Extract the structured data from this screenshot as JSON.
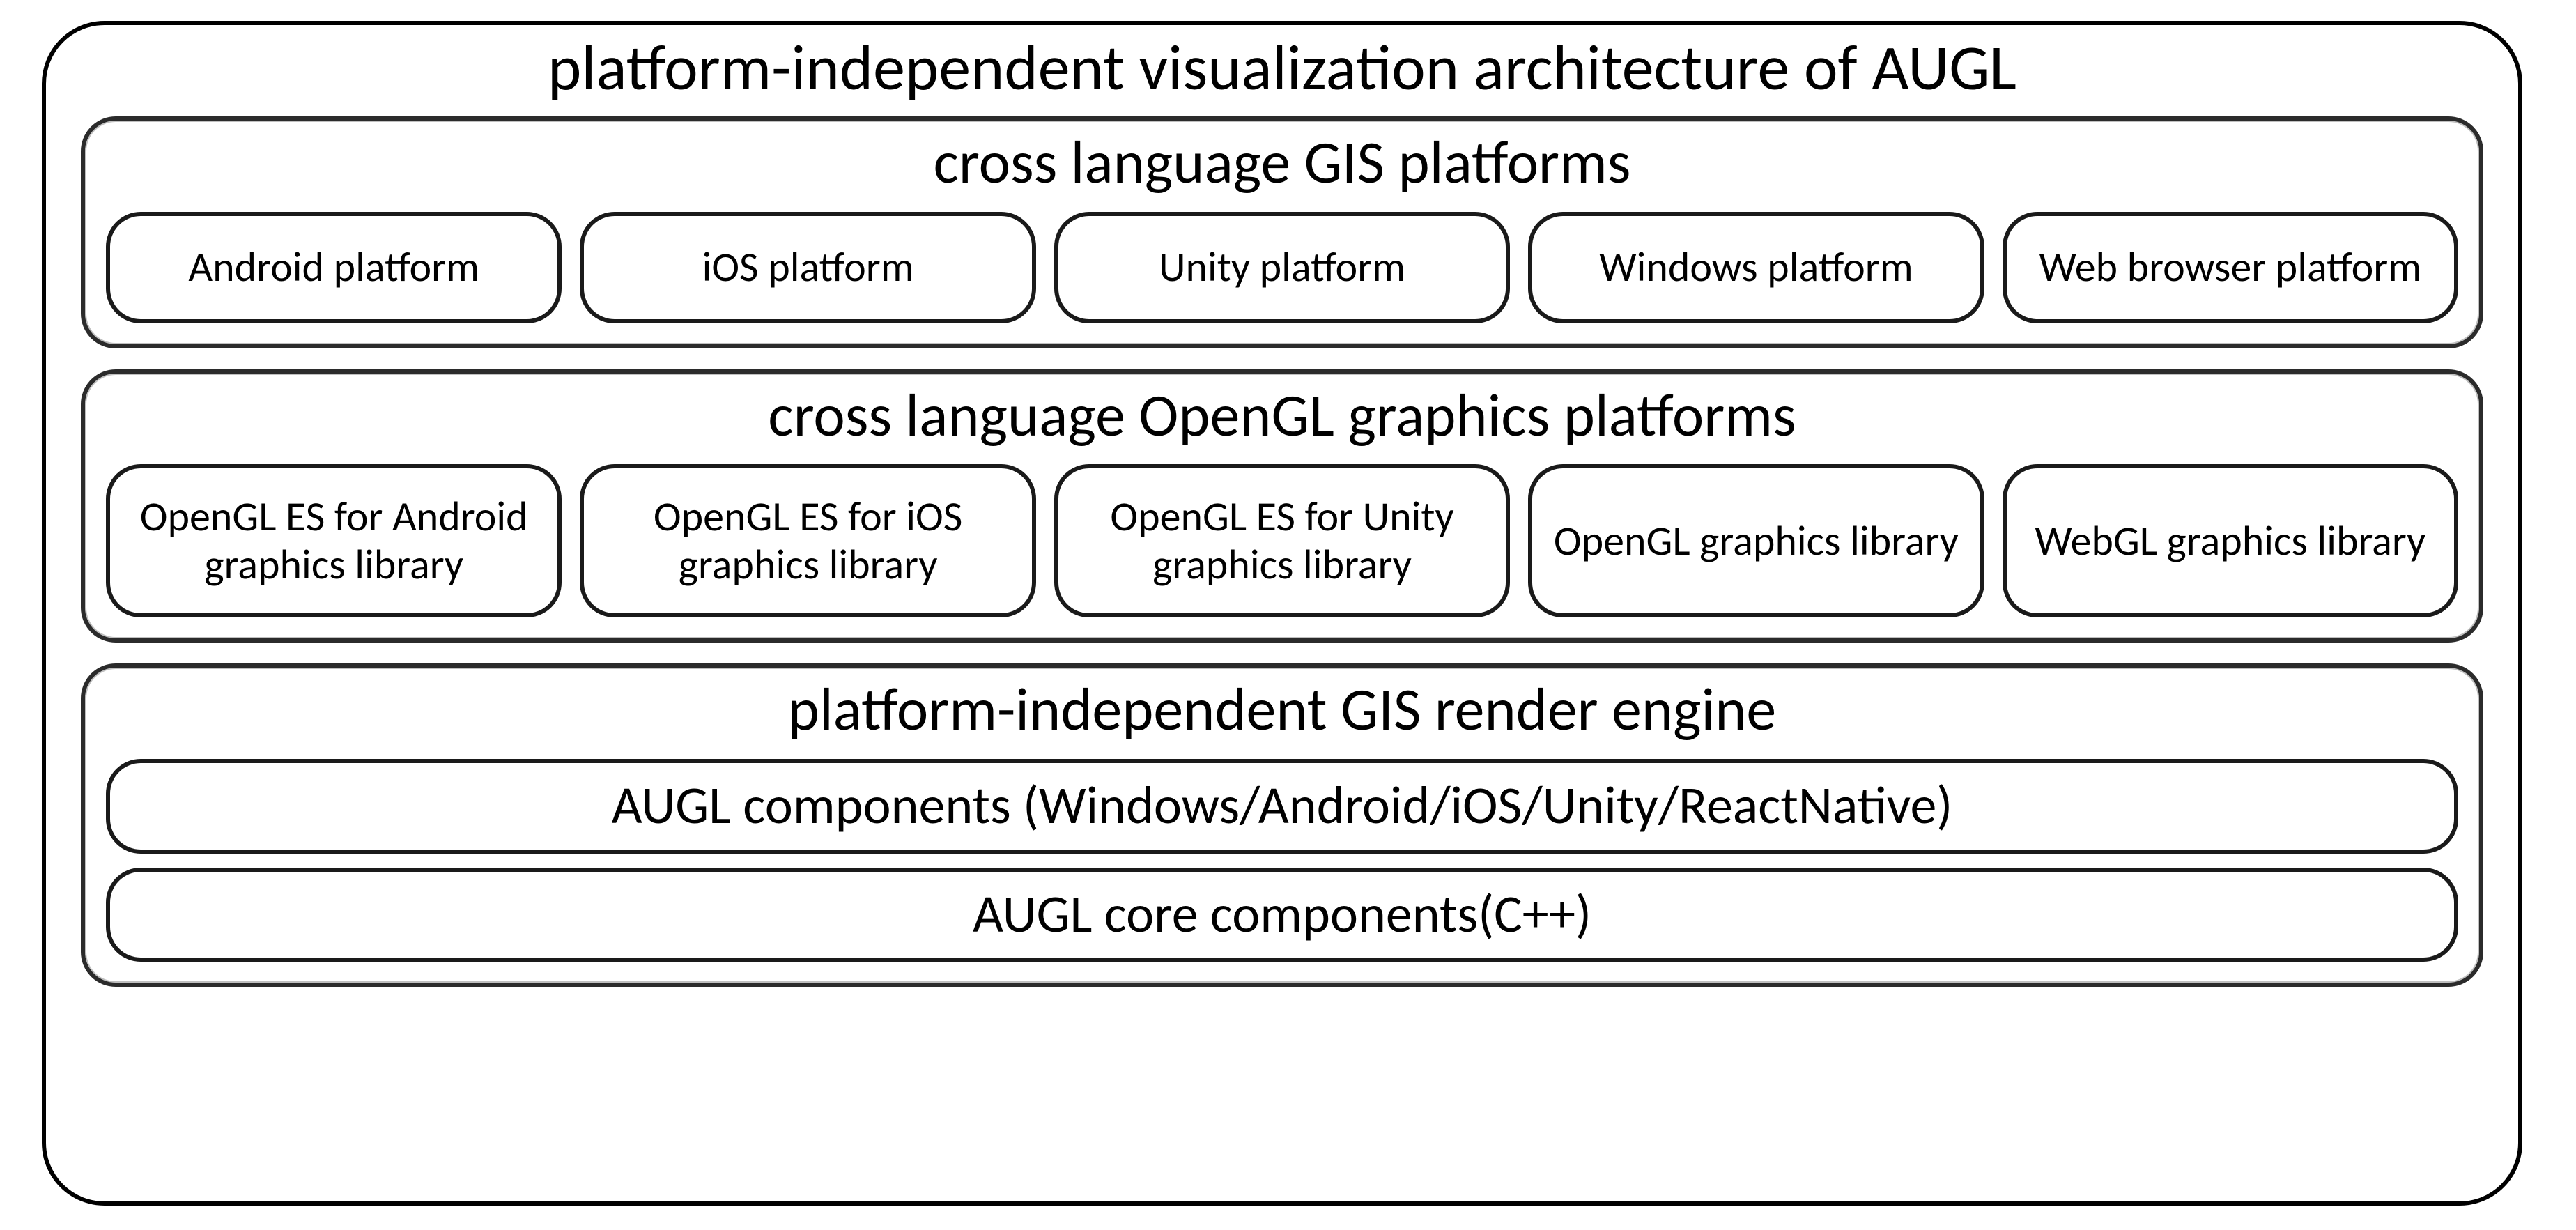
{
  "outer_title": "platform-independent visualization architecture of AUGL",
  "sections": {
    "gis": {
      "title": "cross language GIS platforms",
      "items": [
        "Android platform",
        "iOS platform",
        "Unity platform",
        "Windows platform",
        "Web browser platform"
      ]
    },
    "opengl": {
      "title": "cross language OpenGL graphics platforms",
      "items": [
        "OpenGL ES for Android graphics library",
        "OpenGL ES for iOS graphics library",
        "OpenGL ES for Unity graphics library",
        "OpenGL graphics library",
        "WebGL graphics library"
      ]
    },
    "engine": {
      "title": "platform-independent GIS render engine",
      "rows": [
        "AUGL components (Windows/Android/iOS/Unity/ReactNative)",
        "AUGL core components(C++)"
      ]
    }
  }
}
